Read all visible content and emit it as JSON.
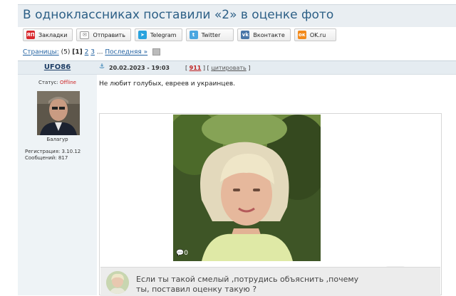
{
  "page": {
    "title": "В одноклассниках поставили «2» в оценке фото"
  },
  "share": [
    {
      "label": "Закладки",
      "icon": "yandex-icon",
      "color": "#d8262b",
      "glyph": "ЯП"
    },
    {
      "label": "Отправить",
      "icon": "mail-icon",
      "color": "#888888",
      "glyph": "✉"
    },
    {
      "label": "Telegram",
      "icon": "telegram-icon",
      "color": "#2aa3de",
      "glyph": "➤"
    },
    {
      "label": "Twitter",
      "icon": "twitter-icon",
      "color": "#4aa6e0",
      "glyph": "t"
    },
    {
      "label": "Вконтакте",
      "icon": "vk-icon",
      "color": "#4a76a8",
      "glyph": "vk"
    },
    {
      "label": "OK.ru",
      "icon": "odnoklassniki-icon",
      "color": "#f28a1b",
      "glyph": "ок"
    }
  ],
  "pagination": {
    "label": "Страницы:",
    "count": "(5)",
    "current": "[1]",
    "p2": "2",
    "p3": "3",
    "ellipsis": "...",
    "last": "Последняя »"
  },
  "author": {
    "name": "UFO86",
    "status_label": "Статус:",
    "status_value": "Offline",
    "rank": "Балагур",
    "registration": "Регистрация: 3.10.12",
    "messages": "Сообщений: 817"
  },
  "post": {
    "anchor": "⚓",
    "date": "20.02.2023 - 19:03",
    "open": "[",
    "count": "911",
    "middle": "] [",
    "cite": "цитировать",
    "close": "]",
    "text": "Не любит голубых, евреев и украинцев."
  },
  "photo": {
    "comments": "0"
  },
  "comment": {
    "line1": "Если ты такой смелый ,потрудись объяснить ,почему",
    "line2": "ты, поставил оценку такую ?"
  }
}
